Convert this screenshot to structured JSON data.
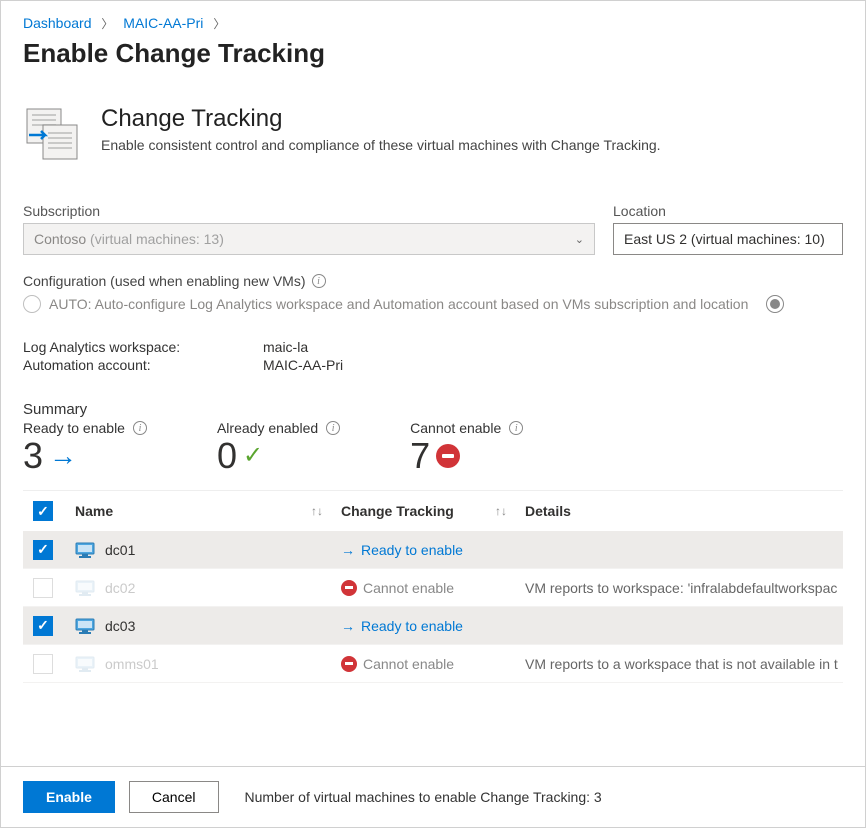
{
  "breadcrumb": {
    "items": [
      "Dashboard",
      "MAIC-AA-Pri"
    ]
  },
  "pageTitle": "Enable Change Tracking",
  "hero": {
    "title": "Change Tracking",
    "subtitle": "Enable consistent control and compliance of these virtual machines with Change Tracking."
  },
  "subscription": {
    "label": "Subscription",
    "value": "Contoso",
    "suffix": "(virtual machines: 13)"
  },
  "location": {
    "label": "Location",
    "value": "East US 2 (virtual machines: 10)"
  },
  "configuration": {
    "label": "Configuration (used when enabling new VMs)",
    "autoLabel": "AUTO: Auto-configure Log Analytics workspace and Automation account based on VMs subscription and location"
  },
  "workspace": {
    "logAnalytics": {
      "label": "Log Analytics workspace:",
      "value": "maic-la"
    },
    "automation": {
      "label": "Automation account:",
      "value": "MAIC-AA-Pri"
    }
  },
  "summary": {
    "label": "Summary",
    "ready": {
      "label": "Ready to enable",
      "value": "3"
    },
    "already": {
      "label": "Already enabled",
      "value": "0"
    },
    "cannot": {
      "label": "Cannot enable",
      "value": "7"
    }
  },
  "table": {
    "headers": {
      "name": "Name",
      "tracking": "Change Tracking",
      "details": "Details"
    },
    "statusLabels": {
      "ready": "Ready to enable",
      "cannot": "Cannot enable"
    },
    "rows": [
      {
        "name": "dc01",
        "status": "ready",
        "checked": true,
        "details": ""
      },
      {
        "name": "dc02",
        "status": "cannot",
        "checked": false,
        "details": "VM reports to workspace: 'infralabdefaultworkspac"
      },
      {
        "name": "dc03",
        "status": "ready",
        "checked": true,
        "details": ""
      },
      {
        "name": "omms01",
        "status": "cannot",
        "checked": false,
        "details": "VM reports to a workspace that is not available in t"
      }
    ]
  },
  "footer": {
    "enable": "Enable",
    "cancel": "Cancel",
    "text": "Number of virtual machines to enable Change Tracking: 3"
  }
}
